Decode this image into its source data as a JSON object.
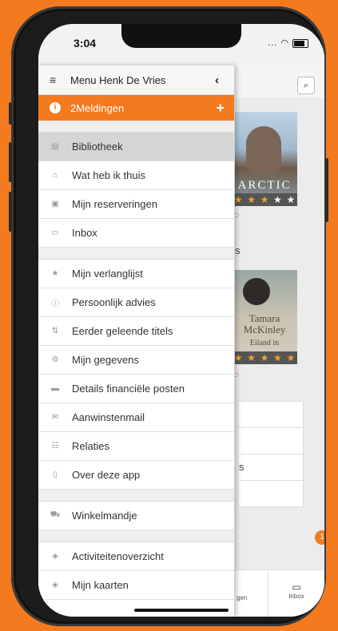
{
  "status": {
    "time": "3:04",
    "icons": "..."
  },
  "drawer": {
    "title": "Menu Henk De Vries",
    "notification": "2Meldingen",
    "groups": [
      [
        {
          "label": "Bibliotheek",
          "icon": "building-icon"
        },
        {
          "label": "Wat heb ik thuis",
          "icon": "home-icon"
        },
        {
          "label": "Mijn reserveringen",
          "icon": "reservation-icon"
        },
        {
          "label": "Inbox",
          "icon": "inbox-icon"
        }
      ],
      [
        {
          "label": "Mijn verlanglijst",
          "icon": "star-icon"
        },
        {
          "label": "Persoonlijk advies",
          "icon": "info-icon"
        },
        {
          "label": "Eerder geleende titels",
          "icon": "sort-icon"
        },
        {
          "label": "Mijn gegevens",
          "icon": "gears-icon"
        },
        {
          "label": "Details financiële posten",
          "icon": "card-icon"
        },
        {
          "label": "Aanwinstenmail",
          "icon": "mail-icon"
        },
        {
          "label": "Relaties",
          "icon": "people-icon"
        },
        {
          "label": "Over deze app",
          "icon": "phone-icon"
        }
      ],
      [
        {
          "label": "Winkelmandje",
          "icon": "cart-icon"
        }
      ],
      [
        {
          "label": "Activiteitenoverzicht",
          "icon": "ticket-icon"
        },
        {
          "label": "Mijn kaarten",
          "icon": "cards-icon"
        }
      ]
    ]
  },
  "background": {
    "book1": {
      "cover_text": "ARCTIC",
      "rating": 3
    },
    "book2": {
      "author": "Tamara McKinley",
      "title": "Eiland in",
      "rating": 4.5
    },
    "partial": {
      "s1": "s",
      "s2": "s",
      "tab_left": "gen"
    },
    "inbox_label": "Inbox",
    "badge": "1"
  }
}
